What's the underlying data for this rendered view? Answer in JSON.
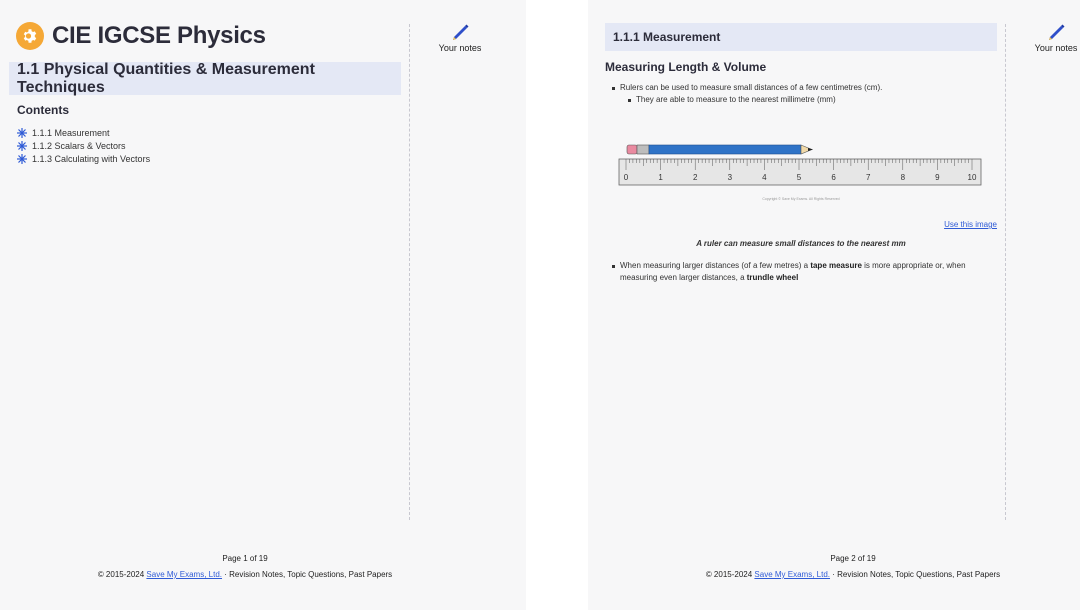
{
  "notes": {
    "label": "Your notes"
  },
  "page1": {
    "brand": "CIE IGCSE Physics",
    "topic_title": "1.1 Physical Quantities & Measurement Techniques",
    "contents_heading": "Contents",
    "contents": [
      "1.1.1 Measurement",
      "1.1.2 Scalars & Vectors",
      "1.1.3 Calculating with Vectors"
    ],
    "footer": {
      "page": "Page 1 of 19",
      "copy_prefix": "© 2015-2024",
      "link": "Save My Exams, Ltd.",
      "copy_suffix": "· Revision Notes, Topic Questions, Past Papers"
    }
  },
  "page2": {
    "section_title": "1.1.1 Measurement",
    "heading": "Measuring Length & Volume",
    "bullet1": "Rulers can be used to measure small distances of a few centimetres (cm).",
    "bullet1_sub": "They are able to measure to the nearest millimetre (mm)",
    "ruler_numbers": [
      "0",
      "1",
      "2",
      "3",
      "4",
      "5",
      "6",
      "7",
      "8",
      "9",
      "10"
    ],
    "ruler_copyright": "Copyright © Save My Exams. All Rights Reserved",
    "use_image": "Use this image",
    "caption": "A ruler can measure small distances to the nearest mm",
    "bullet2_a": "When measuring larger distances (of a few metres) a ",
    "bullet2_b": "tape measure",
    "bullet2_c": " is more appropriate or, when measuring even larger distances, a ",
    "bullet2_d": "trundle wheel",
    "footer": {
      "page": "Page 2 of 19",
      "copy_prefix": "© 2015-2024",
      "link": "Save My Exams, Ltd.",
      "copy_suffix": "· Revision Notes, Topic Questions, Past Papers"
    }
  }
}
